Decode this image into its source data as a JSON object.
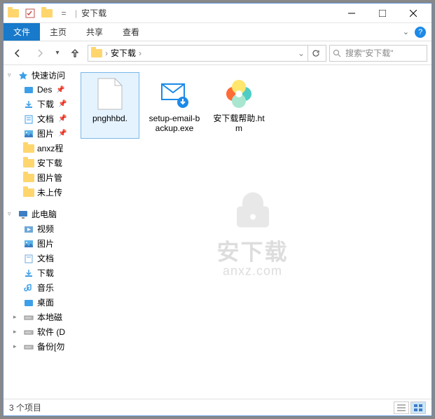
{
  "window": {
    "title": "安下载"
  },
  "qat": {
    "sep": "|"
  },
  "tabs": {
    "file": "文件",
    "home": "主页",
    "share": "共享",
    "view": "查看"
  },
  "nav": {
    "dropdown": "▾"
  },
  "address": {
    "folder": "安下载",
    "sep": "›",
    "dropdown": "⌄"
  },
  "search": {
    "placeholder": "搜索\"安下载\""
  },
  "tree": {
    "quickaccess": {
      "label": "快速访问"
    },
    "qa_items": [
      {
        "label": "Des",
        "pinned": true
      },
      {
        "label": "下载",
        "pinned": true
      },
      {
        "label": "文档",
        "pinned": true
      },
      {
        "label": "图片",
        "pinned": true
      },
      {
        "label": "anxz程",
        "pinned": false
      },
      {
        "label": "安下载",
        "pinned": false
      },
      {
        "label": "图片管",
        "pinned": false
      },
      {
        "label": "未上传",
        "pinned": false
      }
    ],
    "thispc": {
      "label": "此电脑"
    },
    "pc_items": [
      {
        "label": "视频"
      },
      {
        "label": "图片"
      },
      {
        "label": "文档"
      },
      {
        "label": "下载"
      },
      {
        "label": "音乐"
      },
      {
        "label": "桌面"
      },
      {
        "label": "本地磁"
      },
      {
        "label": "软件 (D"
      },
      {
        "label": "备份[勿"
      }
    ]
  },
  "files": [
    {
      "name": "pnghhbd.",
      "type": "file"
    },
    {
      "name": "setup-email-backup.exe",
      "type": "exe"
    },
    {
      "name": "安下载帮助.htm",
      "type": "htm"
    }
  ],
  "watermark": {
    "line1": "安下载",
    "line2": "anxz.com"
  },
  "statusbar": {
    "count": "3 个项目"
  }
}
